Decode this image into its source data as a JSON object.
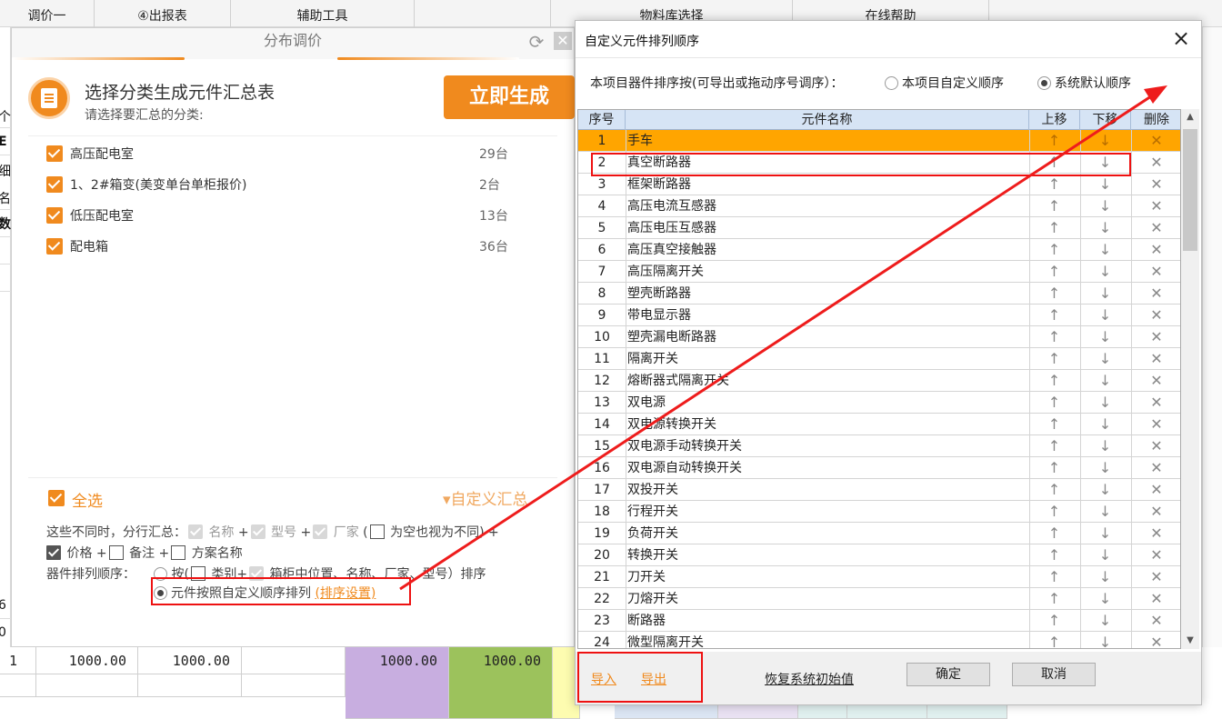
{
  "bg": {
    "toolbar": [
      "调价一",
      "④出报表",
      "辅助工具",
      "",
      "物料库选择",
      "在线帮助"
    ],
    "strip_chars": [
      "个",
      "E",
      "细",
      "名",
      "数",
      "6",
      "0"
    ],
    "bottom_row": {
      "no": "1",
      "v1": "1000.00",
      "v2": "1000.00",
      "v3": "1000.00",
      "v4": "1000.00"
    },
    "colors": {
      "purple": "#c8aee0",
      "green": "#9cc25c",
      "yellow": "#fdfcb0",
      "blue": "#dbe5f3",
      "lavender": "#e9e1f2",
      "mint": "#e0f0ef"
    }
  },
  "price_panel": {
    "title": "分布调价",
    "heading": "选择分类生成元件汇总表",
    "subheading": "请选择要汇总的分类:",
    "generate_label": "立即生成",
    "categories": [
      {
        "name": "高压配电室",
        "count": "29台"
      },
      {
        "name": "1、2#箱变(美变单台单柜报价)",
        "count": "2台"
      },
      {
        "name": "低压配电室",
        "count": "13台"
      },
      {
        "name": "配电箱",
        "count": "36台"
      }
    ],
    "select_all": "全选",
    "custom_summary": "▾自定义汇总",
    "line1_prefix": "这些不同时，分行汇总：",
    "opt_name": "名称",
    "opt_model": "型号",
    "opt_maker": "厂家",
    "opt_empty_diff": "为空也视为不同",
    "opt_price": "价格",
    "opt_remark": "备注",
    "opt_plan": "方案名称",
    "sort_label": "器件排列顺序：",
    "sort_by": "按(",
    "sort_category": "类别+",
    "sort_rest": "箱柜中位置、名称、厂家、型号）排序",
    "sort_custom": "元件按照自定义顺序排列",
    "sort_settings": "(排序设置)"
  },
  "dialog": {
    "title": "自定义元件排列顺序",
    "order_label": "本项目器件排序按(可导出或拖动序号调序）：",
    "opt_custom": "本项目自定义顺序",
    "opt_default": "系统默认顺序",
    "headers": {
      "no": "序号",
      "name": "元件名称",
      "up": "上移",
      "down": "下移",
      "del": "删除"
    },
    "rows": [
      {
        "no": "1",
        "name": "手车"
      },
      {
        "no": "2",
        "name": "真空断路器"
      },
      {
        "no": "3",
        "name": "框架断路器"
      },
      {
        "no": "4",
        "name": "高压电流互感器"
      },
      {
        "no": "5",
        "name": "高压电压互感器"
      },
      {
        "no": "6",
        "name": "高压真空接触器"
      },
      {
        "no": "7",
        "name": "高压隔离开关"
      },
      {
        "no": "8",
        "name": "塑壳断路器"
      },
      {
        "no": "9",
        "name": "带电显示器"
      },
      {
        "no": "10",
        "name": "塑壳漏电断路器"
      },
      {
        "no": "11",
        "name": "隔离开关"
      },
      {
        "no": "12",
        "name": "熔断器式隔离开关"
      },
      {
        "no": "13",
        "name": "双电源"
      },
      {
        "no": "14",
        "name": "双电源转换开关"
      },
      {
        "no": "15",
        "name": "双电源手动转换开关"
      },
      {
        "no": "16",
        "name": "双电源自动转换开关"
      },
      {
        "no": "17",
        "name": "双投开关"
      },
      {
        "no": "18",
        "name": "行程开关"
      },
      {
        "no": "19",
        "name": "负荷开关"
      },
      {
        "no": "20",
        "name": "转换开关"
      },
      {
        "no": "21",
        "name": "刀开关"
      },
      {
        "no": "22",
        "name": "刀熔开关"
      },
      {
        "no": "23",
        "name": "断路器"
      },
      {
        "no": "24",
        "name": "微型隔离开关"
      }
    ],
    "up_glyph": "↑",
    "down_glyph": "↓",
    "del_glyph": "✕",
    "import": "导入",
    "export": "导出",
    "restore": "恢复系统初始值",
    "ok": "确定",
    "cancel": "取消",
    "selected_row_color": "#ffa500"
  },
  "annotation_color": "#e11"
}
